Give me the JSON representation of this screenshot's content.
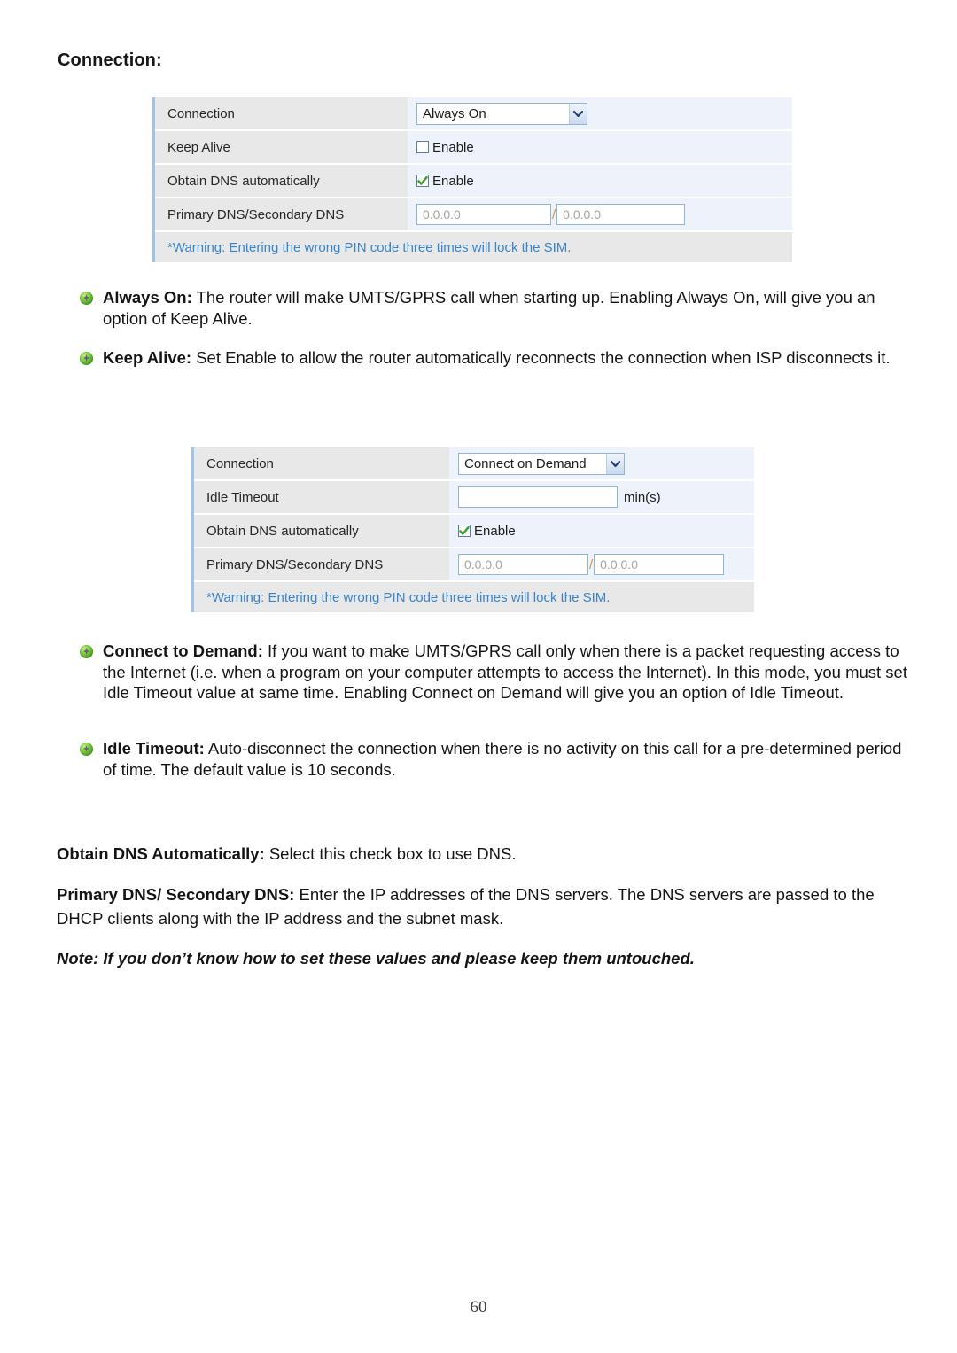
{
  "heading": "Connection:",
  "colors": {
    "label_bg": "#e8e8e8",
    "field_bg": "#eef3fb",
    "warning_text": "#3a83c6",
    "select_border": "#8fb4d4",
    "panel_accent": "#9fc4e8",
    "check_mark": "#3aa021"
  },
  "panel_always_on": {
    "rows": [
      {
        "label": "Connection",
        "type": "select",
        "value": "Always On"
      },
      {
        "label": "Keep Alive",
        "type": "checkbox",
        "checked": false,
        "value": "Enable"
      },
      {
        "label": "Obtain DNS automatically",
        "type": "checkbox",
        "checked": true,
        "value": "Enable"
      },
      {
        "label": "Primary DNS/Secondary DNS",
        "type": "dns",
        "primary": "0.0.0.0",
        "separator": "/",
        "secondary": "0.0.0.0"
      }
    ],
    "warning": "*Warning: Entering the wrong PIN code three times will lock the SIM."
  },
  "panel_connect_on_demand": {
    "rows": [
      {
        "label": "Connection",
        "type": "select",
        "value": "Connect on Demand"
      },
      {
        "label": "Idle Timeout",
        "type": "input",
        "value": "",
        "unit": "min(s)"
      },
      {
        "label": "Obtain DNS automatically",
        "type": "checkbox",
        "checked": true,
        "value": "Enable"
      },
      {
        "label": "Primary DNS/Secondary DNS",
        "type": "dns",
        "primary": "0.0.0.0",
        "separator": "/",
        "secondary": "0.0.0.0"
      }
    ],
    "warning": "*Warning: Entering the wrong PIN code three times will lock the SIM."
  },
  "bullets": [
    {
      "term": "Always On:",
      "body": " The router will make UMTS/GPRS call when starting up. Enabling Always On, will give you an option of Keep Alive."
    },
    {
      "term": "Keep Alive:",
      "body": " Set Enable to allow the router automatically reconnects the connection when ISP disconnects it."
    },
    {
      "term": "Connect to Demand:",
      "body": " If you want to make UMTS/GPRS call only when there is a packet requesting access to the Internet (i.e. when a program on your computer attempts to access the Internet). In this mode, you must set Idle Timeout value at same time. Enabling Connect on Demand will give you an option of Idle Timeout."
    },
    {
      "term": "Idle Timeout:",
      "body": " Auto-disconnect the connection when there is no activity on this call for a pre-determined period of time. The default value is 10 seconds."
    }
  ],
  "paragraphs": [
    {
      "term": "Obtain DNS Automatically:",
      "body": " Select this check box to use DNS."
    },
    {
      "term": "Primary DNS/ Secondary DNS:",
      "body": " Enter the IP addresses of the DNS servers. The DNS servers are passed to the DHCP clients along with the IP address and the subnet mask."
    }
  ],
  "note": "Note: If you don’t know how to set these values and please keep them untouched.",
  "page_number": "60"
}
